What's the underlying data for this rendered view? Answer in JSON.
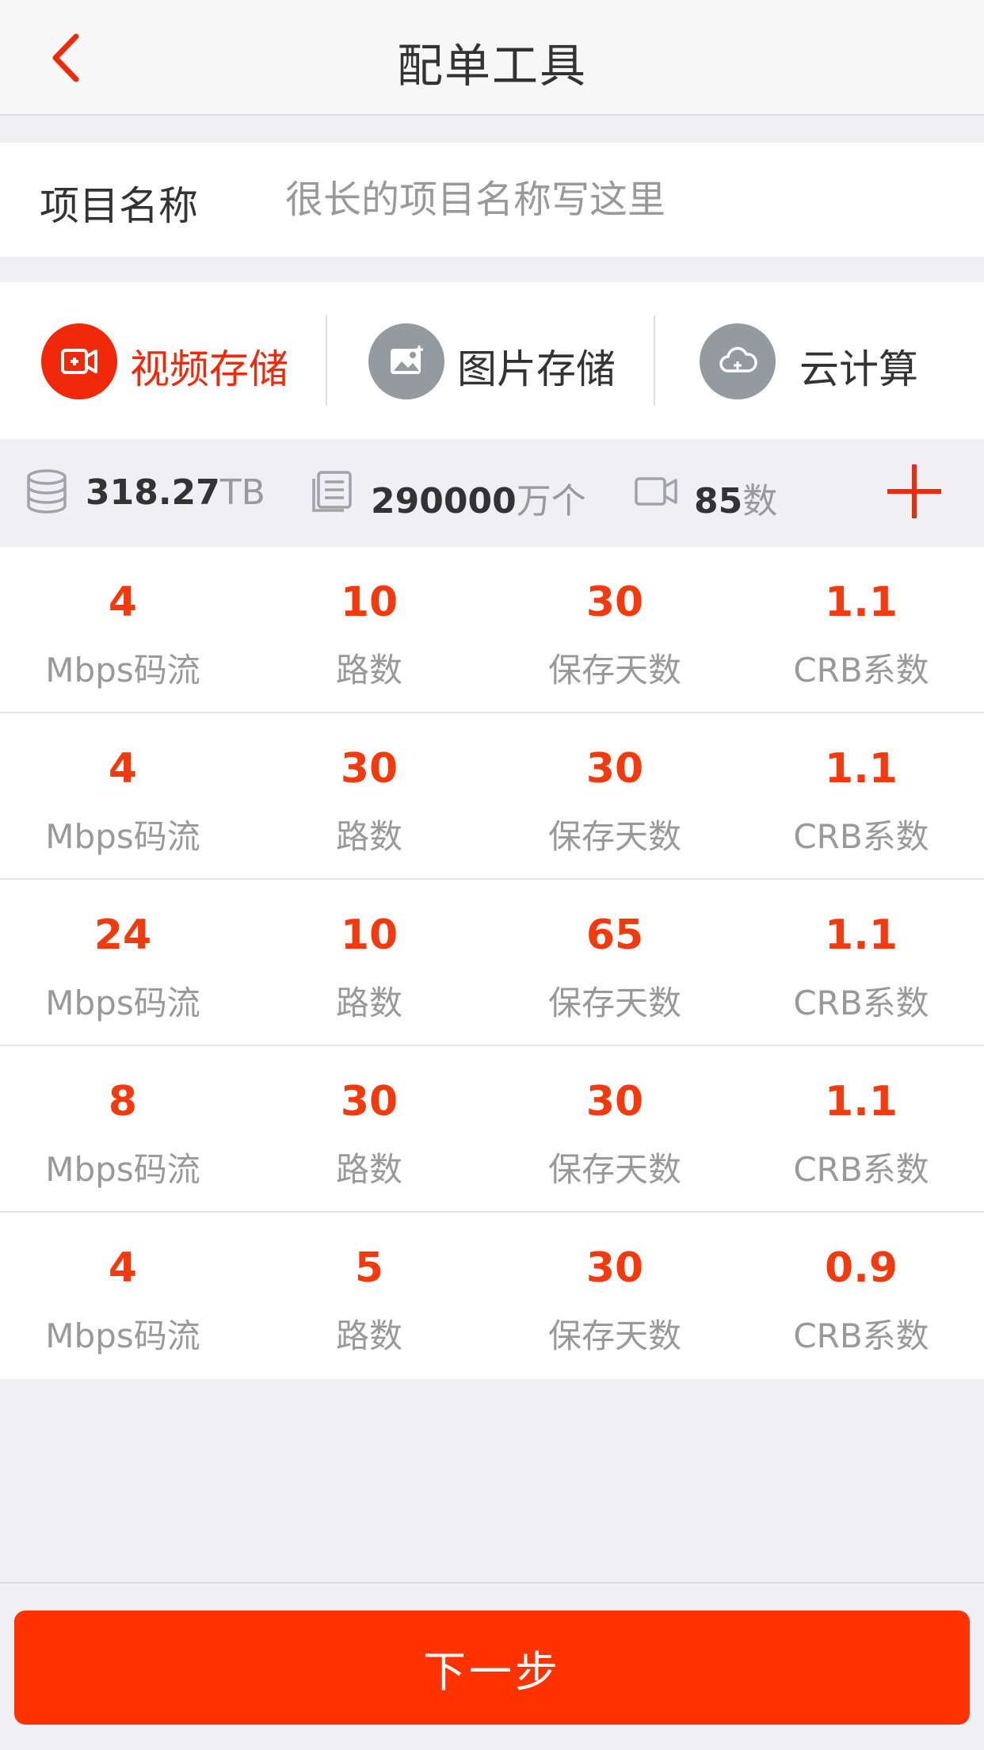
{
  "navbar": {
    "title": "配单工具",
    "back_icon": "chevron-left-icon"
  },
  "project": {
    "label": "项目名称",
    "placeholder": "很长的项目名称写这里",
    "value": ""
  },
  "tabs": [
    {
      "label": "视频存储",
      "icon": "video-icon",
      "active": true
    },
    {
      "label": "图片存储",
      "icon": "image-icon",
      "active": false
    },
    {
      "label": "云计算",
      "icon": "cloud-icon",
      "active": false
    }
  ],
  "summary": {
    "storage": {
      "icon": "database-icon",
      "value": "318.27",
      "unit": "TB"
    },
    "files": {
      "icon": "document-icon",
      "value": "290000",
      "unit": "万个"
    },
    "cameras": {
      "icon": "camera-icon",
      "value": "85",
      "unit": "数"
    },
    "add_icon": "plus-icon"
  },
  "row_labels": [
    "Mbps码流",
    "路数",
    "保存天数",
    "CRB系数"
  ],
  "rows": [
    {
      "bitrate": "4",
      "channels": "10",
      "days": "30",
      "crb": "1.1"
    },
    {
      "bitrate": "4",
      "channels": "30",
      "days": "30",
      "crb": "1.1"
    },
    {
      "bitrate": "24",
      "channels": "10",
      "days": "65",
      "crb": "1.1"
    },
    {
      "bitrate": "8",
      "channels": "30",
      "days": "30",
      "crb": "1.1"
    },
    {
      "bitrate": "4",
      "channels": "5",
      "days": "30",
      "crb": "0.9"
    }
  ],
  "footer": {
    "next_label": "下一步"
  },
  "colors": {
    "accent": "#f0290a",
    "value_red": "#f33a0f",
    "button": "#ff3300",
    "inactive_icon": "#939aa0"
  }
}
